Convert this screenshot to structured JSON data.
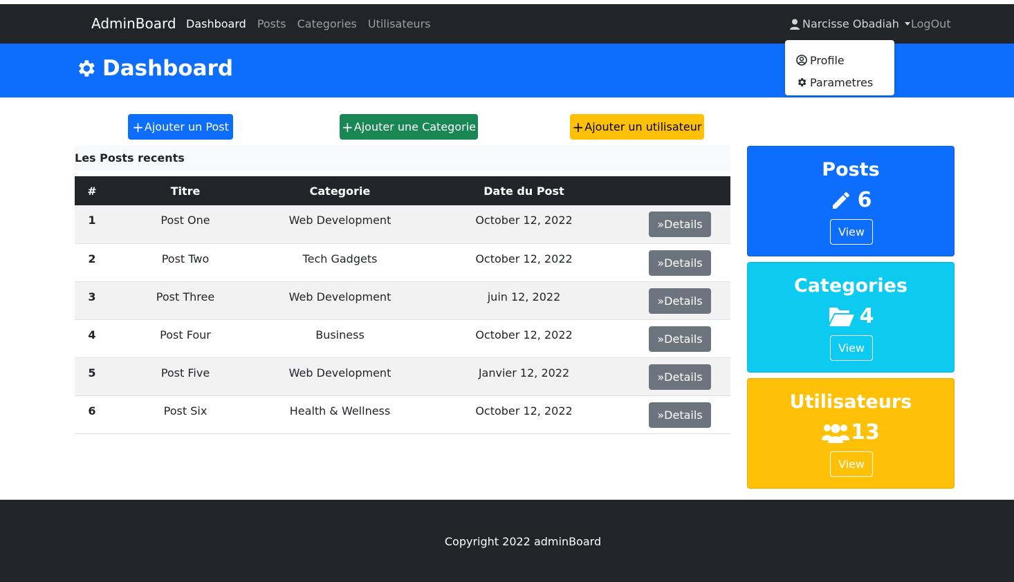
{
  "navbar": {
    "brand": "AdminBoard",
    "links": [
      {
        "label": "Dashboard",
        "active": true
      },
      {
        "label": "Posts"
      },
      {
        "label": "Categories"
      },
      {
        "label": "Utilisateurs"
      }
    ],
    "user_name": "Narcisse Obadiah",
    "logout": "LogOut"
  },
  "dropdown": {
    "items": [
      {
        "label": "Profile",
        "icon": "user-circle-icon"
      },
      {
        "label": "Parametres",
        "icon": "gear-icon"
      }
    ]
  },
  "header": {
    "title": "Dashboard",
    "icon": "gear-icon"
  },
  "actions": {
    "add_post": "Ajouter un Post",
    "add_category": "Ajouter une Categorie",
    "add_user": "Ajouter un utilisateur"
  },
  "recent": {
    "title": "Les Posts recents"
  },
  "table": {
    "headers": [
      "#",
      "Titre",
      "Categorie",
      "Date du Post",
      ""
    ],
    "details_label": "Details",
    "rows": [
      {
        "num": "1",
        "title": "Post One",
        "category": "Web Development",
        "date": "October 12, 2022"
      },
      {
        "num": "2",
        "title": "Post Two",
        "category": "Tech Gadgets",
        "date": "October 12, 2022"
      },
      {
        "num": "3",
        "title": "Post Three",
        "category": "Web Development",
        "date": "juin 12, 2022"
      },
      {
        "num": "4",
        "title": "Post Four",
        "category": "Business",
        "date": "October 12, 2022"
      },
      {
        "num": "5",
        "title": "Post Five",
        "category": "Web Development",
        "date": "Janvier 12, 2022"
      },
      {
        "num": "6",
        "title": "Post Six",
        "category": "Health & Wellness",
        "date": "October 12, 2022"
      }
    ]
  },
  "cards": {
    "posts": {
      "title": "Posts",
      "count": "6",
      "view": "View",
      "icon": "pencil-icon",
      "color": "#0d6efd"
    },
    "categories": {
      "title": "Categories",
      "count": "4",
      "view": "View",
      "icon": "folder-open-icon",
      "color": "#0dcaf0"
    },
    "users": {
      "title": "Utilisateurs",
      "count": "13",
      "view": "View",
      "icon": "users-icon",
      "color": "#ffc107"
    }
  },
  "footer": {
    "text": "Copyright 2022 adminBoard"
  },
  "colors": {
    "primary": "#0d6efd",
    "success": "#198754",
    "warning": "#ffc107",
    "info": "#0dcaf0",
    "dark": "#212529",
    "secondary": "#6c757d"
  }
}
